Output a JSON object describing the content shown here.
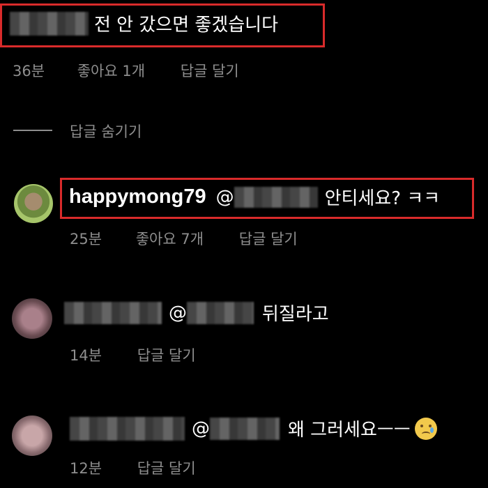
{
  "comment1": {
    "text": "전 안 갔으면 좋겠습니다",
    "time": "36분",
    "likes": "좋아요 1개",
    "reply": "답글 달기"
  },
  "hide_replies": "답글 숨기기",
  "comment2": {
    "username": "happymong79",
    "mention_at": "@",
    "text": "안티세요? ㅋㅋ",
    "time": "25분",
    "likes": "좋아요 7개",
    "reply": "답글 달기"
  },
  "comment3": {
    "mention_at": "@",
    "text": "뒤질라고",
    "time": "14분",
    "reply": "답글 달기"
  },
  "comment4": {
    "mention_at": "@",
    "text": "왜 그러세요ㅡㅡ",
    "emoji": "😢",
    "time": "12분",
    "reply": "답글 달기"
  },
  "colors": {
    "background": "#000000",
    "highlight": "#d92b2b",
    "meta_text": "#8e8e8e"
  }
}
